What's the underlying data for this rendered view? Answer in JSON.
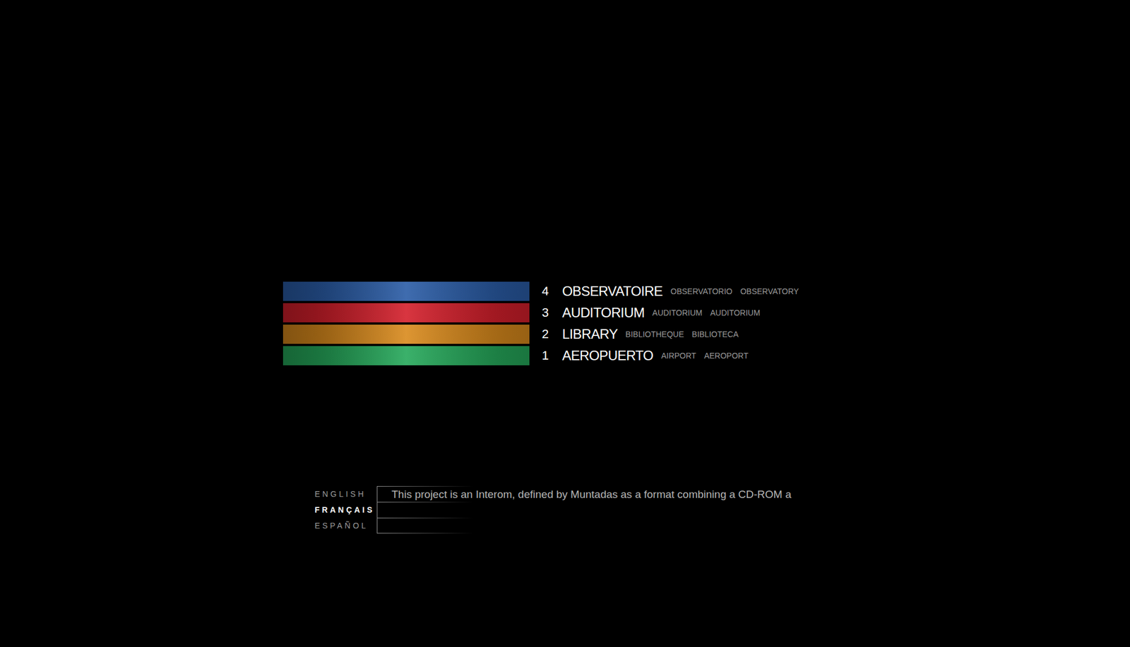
{
  "menu": [
    {
      "number": "4",
      "title": "OBSERVATOIRE",
      "translations": [
        "OBSERVATORIO",
        "OBSERVATORY"
      ],
      "color": "#2a5ca6"
    },
    {
      "number": "3",
      "title": "AUDITORIUM",
      "translations": [
        "AUDITORIUM",
        "AUDITORIUM"
      ],
      "color": "#d41f2b"
    },
    {
      "number": "2",
      "title": "LIBRARY",
      "translations": [
        "BIBLIOTHEQUE",
        "BIBLIOTECA"
      ],
      "color": "#d98a1c"
    },
    {
      "number": "1",
      "title": "AEROPUERTO",
      "translations": [
        "AIRPORT",
        "AEROPORT"
      ],
      "color": "#25a85a"
    }
  ],
  "languages": [
    {
      "label": "ENGLISH",
      "selected": false
    },
    {
      "label": "FRANÇAIS",
      "selected": true
    },
    {
      "label": "ESPAÑOL",
      "selected": false
    }
  ],
  "description": "This project is an Interom, defined by Muntadas as a format combining a CD-ROM a"
}
